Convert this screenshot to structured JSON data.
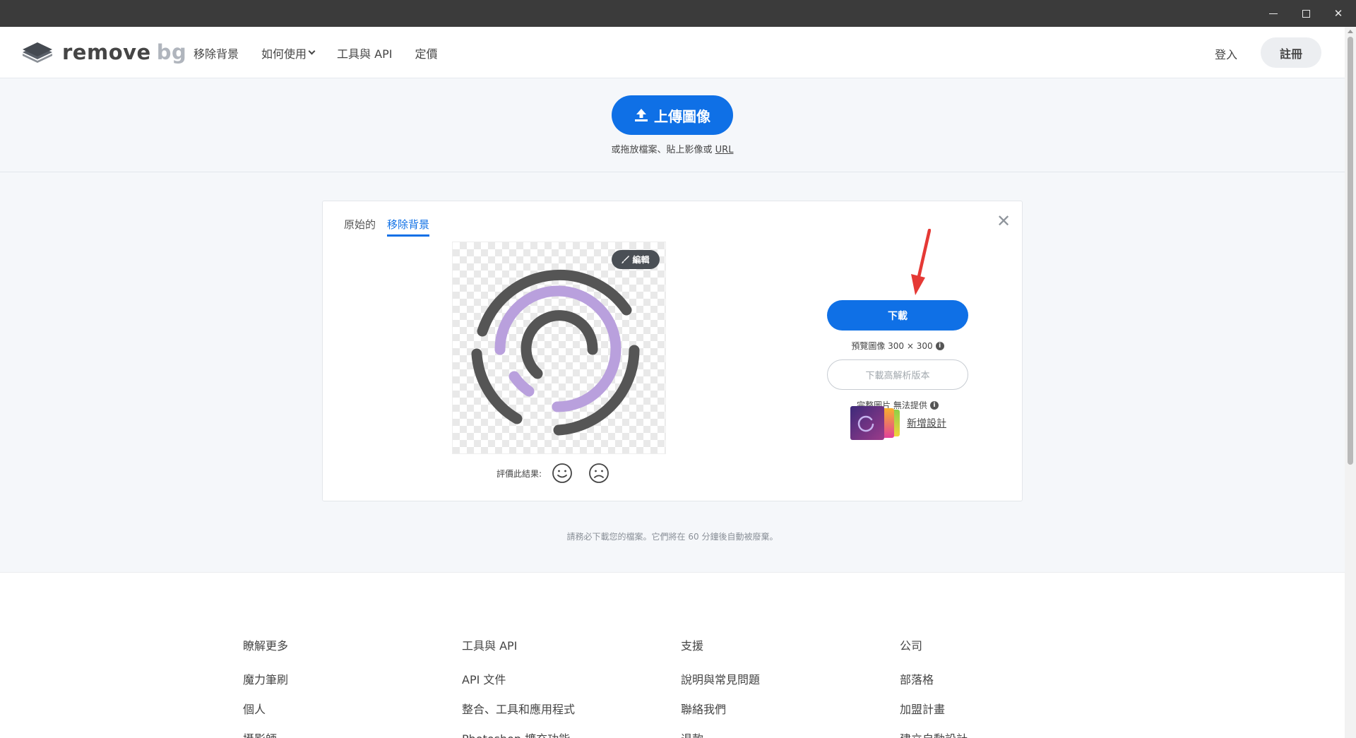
{
  "window": {
    "controls": [
      "minimize",
      "maximize",
      "close"
    ]
  },
  "header": {
    "logo": {
      "word1": "remove",
      "word2": "bg"
    },
    "nav": [
      {
        "label": "移除背景"
      },
      {
        "label": "如何使用"
      },
      {
        "label": "工具與 API"
      },
      {
        "label": "定價"
      }
    ],
    "login": "登入",
    "signup": "註冊"
  },
  "upload": {
    "button": "上傳圖像",
    "hint": "或拖放檔案、貼上影像或",
    "url": "URL"
  },
  "result": {
    "tabs": [
      {
        "label": "原始的",
        "active": false
      },
      {
        "label": "移除背景",
        "active": true
      }
    ],
    "close": "✕",
    "edit": "編輯",
    "rate_label": "評價此結果:",
    "download": "下載",
    "preview_info": "預覽圖像 300 × 300",
    "hd_download": "下載高解析版本",
    "hd_info": "完整圖片 無法提供",
    "new_design": "新增設計"
  },
  "notice": "請務必下載您的檔案。它們將在 60 分鐘後自動被廢棄。",
  "footer": {
    "columns": [
      {
        "title": "瞭解更多",
        "links": [
          "魔力筆刷",
          "個人",
          "攝影師"
        ]
      },
      {
        "title": "工具與 API",
        "links": [
          "API 文件",
          "整合、工具和應用程式",
          "Photoshop 擴充功能"
        ]
      },
      {
        "title": "支援",
        "links": [
          "說明與常見問題",
          "聯絡我們",
          "退款"
        ]
      },
      {
        "title": "公司",
        "links": [
          "部落格",
          "加盟計畫",
          "建立自動設計"
        ]
      }
    ]
  },
  "colors": {
    "accent": "#0f70e6",
    "ring_gray": "#555555",
    "ring_purple": "#b9a0dd",
    "arrow": "#e53935"
  }
}
